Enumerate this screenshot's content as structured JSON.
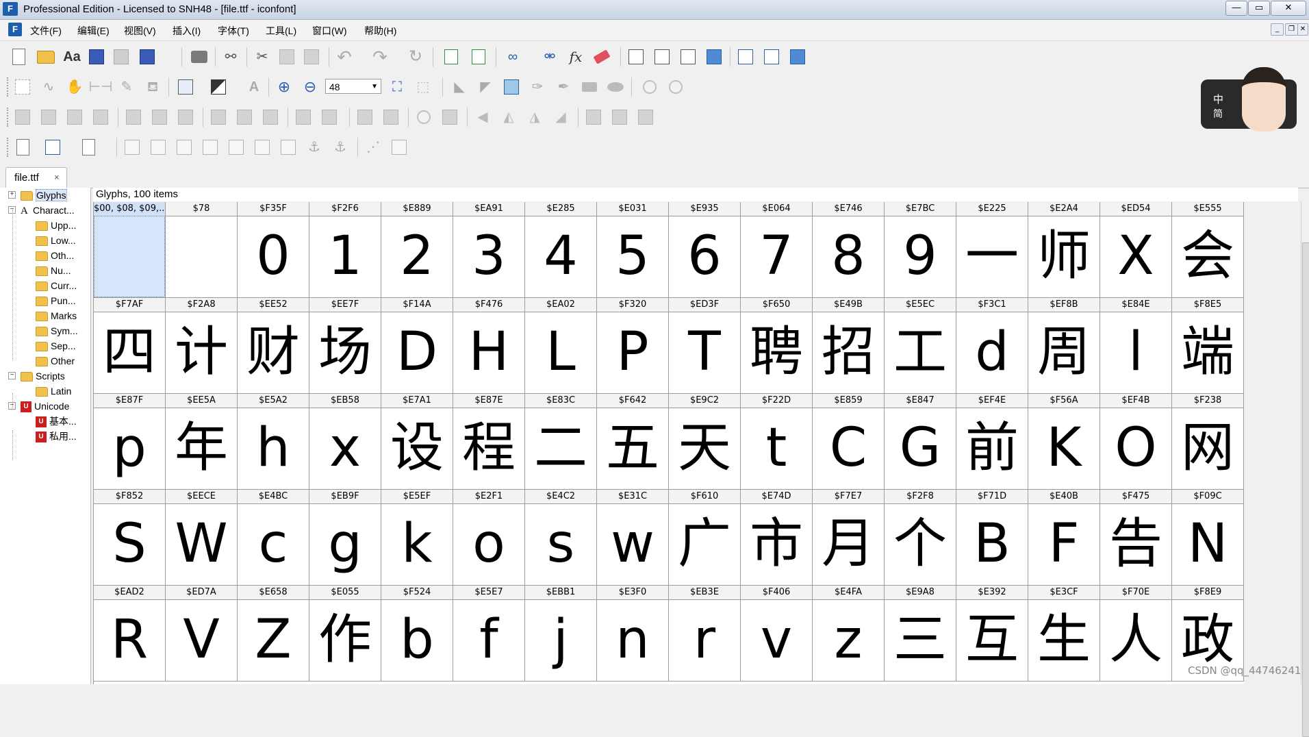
{
  "window": {
    "title": "Professional Edition - Licensed to SNH48 - [file.ttf - iconfont]",
    "app_icon": "F"
  },
  "menu": {
    "items": [
      "文件(F)",
      "编辑(E)",
      "视图(V)",
      "插入(I)",
      "字体(T)",
      "工具(L)",
      "窗口(W)",
      "帮助(H)"
    ]
  },
  "toolbar": {
    "zoom_value": "48"
  },
  "mascot": {
    "line1": "中",
    "line2": "简"
  },
  "tab": {
    "label": "file.ttf",
    "close": "×"
  },
  "tree": {
    "items": [
      {
        "label": "Glyphs",
        "icon": "folder",
        "level": 0,
        "exp": "+",
        "selected": true
      },
      {
        "label": "Charact...",
        "icon": "A",
        "level": 0,
        "exp": "−"
      },
      {
        "label": "Upp...",
        "icon": "folder",
        "level": 1
      },
      {
        "label": "Low...",
        "icon": "folder",
        "level": 1
      },
      {
        "label": "Oth...",
        "icon": "folder",
        "level": 1
      },
      {
        "label": "Nu...",
        "icon": "folder",
        "level": 1
      },
      {
        "label": "Curr...",
        "icon": "folder",
        "level": 1
      },
      {
        "label": "Pun...",
        "icon": "folder",
        "level": 1
      },
      {
        "label": "Marks",
        "icon": "folder",
        "level": 1
      },
      {
        "label": "Sym...",
        "icon": "folder",
        "level": 1
      },
      {
        "label": "Sep...",
        "icon": "folder",
        "level": 1
      },
      {
        "label": "Other",
        "icon": "folder",
        "level": 1
      },
      {
        "label": "Scripts",
        "icon": "folder",
        "level": 0,
        "exp": "−"
      },
      {
        "label": "Latin",
        "icon": "folder",
        "level": 1
      },
      {
        "label": "Unicode",
        "icon": "unicode",
        "level": 0,
        "exp": "−"
      },
      {
        "label": "基本...",
        "icon": "unicode",
        "level": 1
      },
      {
        "label": "私用...",
        "icon": "unicode",
        "level": 1
      }
    ]
  },
  "grid": {
    "header": "Glyphs, 100 items",
    "rows": [
      [
        [
          "$00, $08, $09,...",
          ""
        ],
        [
          "$78",
          ""
        ],
        [
          "$F35F",
          "0"
        ],
        [
          "$F2F6",
          "1"
        ],
        [
          "$E889",
          "2"
        ],
        [
          "$EA91",
          "3"
        ],
        [
          "$E285",
          "4"
        ],
        [
          "$E031",
          "5"
        ],
        [
          "$E935",
          "6"
        ],
        [
          "$E064",
          "7"
        ],
        [
          "$E746",
          "8"
        ],
        [
          "$E7BC",
          "9"
        ],
        [
          "$E225",
          "一"
        ],
        [
          "$E2A4",
          "师"
        ],
        [
          "$ED54",
          "X"
        ],
        [
          "$E555",
          "会"
        ]
      ],
      [
        [
          "$F7AF",
          "四"
        ],
        [
          "$F2A8",
          "计"
        ],
        [
          "$EE52",
          "财"
        ],
        [
          "$EE7F",
          "场"
        ],
        [
          "$F14A",
          "D"
        ],
        [
          "$F476",
          "H"
        ],
        [
          "$EA02",
          "L"
        ],
        [
          "$F320",
          "P"
        ],
        [
          "$ED3F",
          "T"
        ],
        [
          "$F650",
          "聘"
        ],
        [
          "$E49B",
          "招"
        ],
        [
          "$E5EC",
          "工"
        ],
        [
          "$F3C1",
          "d"
        ],
        [
          "$EF8B",
          "周"
        ],
        [
          "$E84E",
          "l"
        ],
        [
          "$F8E5",
          "端"
        ]
      ],
      [
        [
          "$E87F",
          "p"
        ],
        [
          "$EE5A",
          "年"
        ],
        [
          "$E5A2",
          "h"
        ],
        [
          "$EB58",
          "x"
        ],
        [
          "$E7A1",
          "设"
        ],
        [
          "$E87E",
          "程"
        ],
        [
          "$E83C",
          "二"
        ],
        [
          "$F642",
          "五"
        ],
        [
          "$E9C2",
          "天"
        ],
        [
          "$F22D",
          "t"
        ],
        [
          "$E859",
          "C"
        ],
        [
          "$E847",
          "G"
        ],
        [
          "$EF4E",
          "前"
        ],
        [
          "$F56A",
          "K"
        ],
        [
          "$EF4B",
          "O"
        ],
        [
          "$F238",
          "网"
        ]
      ],
      [
        [
          "$F852",
          "S"
        ],
        [
          "$EECE",
          "W"
        ],
        [
          "$E4BC",
          "c"
        ],
        [
          "$EB9F",
          "g"
        ],
        [
          "$E5EF",
          "k"
        ],
        [
          "$E2F1",
          "o"
        ],
        [
          "$E4C2",
          "s"
        ],
        [
          "$E31C",
          "w"
        ],
        [
          "$F610",
          "广"
        ],
        [
          "$E74D",
          "市"
        ],
        [
          "$F7E7",
          "月"
        ],
        [
          "$F2F8",
          "个"
        ],
        [
          "$F71D",
          "B"
        ],
        [
          "$E40B",
          "F"
        ],
        [
          "$F475",
          "告"
        ],
        [
          "$F09C",
          "N"
        ]
      ],
      [
        [
          "$EAD2",
          "R"
        ],
        [
          "$ED7A",
          "V"
        ],
        [
          "$E658",
          "Z"
        ],
        [
          "$E055",
          "作"
        ],
        [
          "$F524",
          "b"
        ],
        [
          "$E5E7",
          "f"
        ],
        [
          "$EBB1",
          "j"
        ],
        [
          "$E3F0",
          "n"
        ],
        [
          "$EB3E",
          "r"
        ],
        [
          "$F406",
          "v"
        ],
        [
          "$E4FA",
          "z"
        ],
        [
          "$E9A8",
          "三"
        ],
        [
          "$E392",
          "互"
        ],
        [
          "$E3CF",
          "生"
        ],
        [
          "$F70E",
          "人"
        ],
        [
          "$F8E9",
          "政"
        ]
      ]
    ]
  },
  "watermark": "CSDN @qq_44746241"
}
